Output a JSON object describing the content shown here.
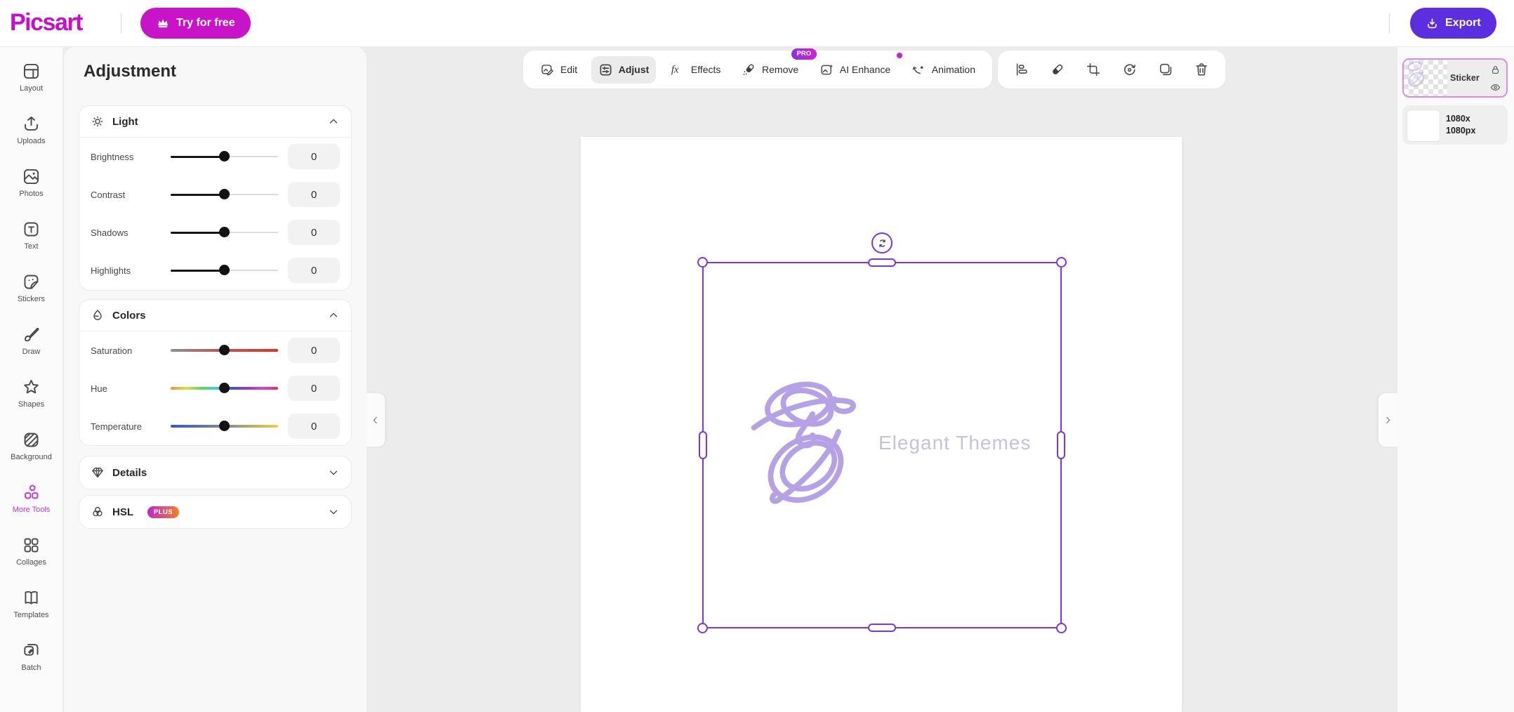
{
  "header": {
    "logo": "Picsart",
    "try_for_free": "Try for free",
    "export": "Export"
  },
  "sidebar": {
    "items": [
      {
        "label": "Layout"
      },
      {
        "label": "Uploads"
      },
      {
        "label": "Photos"
      },
      {
        "label": "Text"
      },
      {
        "label": "Stickers"
      },
      {
        "label": "Draw"
      },
      {
        "label": "Shapes"
      },
      {
        "label": "Background"
      },
      {
        "label": "More Tools",
        "active": true
      },
      {
        "label": "Collages"
      },
      {
        "label": "Templates"
      },
      {
        "label": "Batch"
      }
    ]
  },
  "panel": {
    "title": "Adjustment",
    "sections": {
      "light": {
        "title": "Light",
        "expanded": true,
        "sliders": [
          {
            "label": "Brightness",
            "value": "0"
          },
          {
            "label": "Contrast",
            "value": "0"
          },
          {
            "label": "Shadows",
            "value": "0"
          },
          {
            "label": "Highlights",
            "value": "0"
          }
        ]
      },
      "colors": {
        "title": "Colors",
        "expanded": true,
        "sliders": [
          {
            "label": "Saturation",
            "value": "0",
            "gradient": "gray-to-red"
          },
          {
            "label": "Hue",
            "value": "0",
            "gradient": "rainbow"
          },
          {
            "label": "Temperature",
            "value": "0",
            "gradient": "blue-gray-yellow"
          }
        ]
      },
      "details": {
        "title": "Details",
        "expanded": false
      },
      "hsl": {
        "title": "HSL",
        "badge": "PLUS",
        "expanded": false
      }
    }
  },
  "toolbar": {
    "tools": [
      {
        "label": "Edit"
      },
      {
        "label": "Adjust",
        "active": true
      },
      {
        "label": "Effects"
      },
      {
        "label": "Remove",
        "badge": "PRO"
      },
      {
        "label": "AI Enhance",
        "new_dot": true
      },
      {
        "label": "Animation"
      }
    ],
    "actions": [
      "align",
      "eraser",
      "crop",
      "rotate",
      "duplicate",
      "delete"
    ]
  },
  "canvas": {
    "logo_text": "Elegant Themes"
  },
  "layers": {
    "sticker": {
      "name": "Sticker",
      "selected": true
    },
    "background": {
      "size_line1": "1080x",
      "size_line2": "1080px"
    }
  },
  "colors": {
    "brand_magenta": "#cb0dcb",
    "try_free_button": "#c913c9",
    "export_button": "#5b2ee0",
    "selection_purple": "#7c35ea",
    "active_tool_magenta": "#c433d6",
    "sticker_logo_lavender": "#b5a2e6",
    "workspace_gray": "#ececec"
  },
  "icons": {
    "crown-icon": "♛",
    "download-icon": "⭳",
    "sun-icon": "☀",
    "droplet-icon": "💧",
    "gem-icon": "◆",
    "hsl-circles-icon": "◌◌◌",
    "chevron-up-icon": "⌃",
    "chevron-down-icon": "⌄",
    "lock-icon": "🔒",
    "eye-icon": "👁",
    "rotate-icon": "⟳",
    "trash-icon": "🗑",
    "crop-icon": "⌗"
  }
}
